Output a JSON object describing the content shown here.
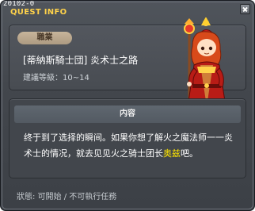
{
  "window": {
    "quest_id": "20102-0",
    "title": "QUEST INFO"
  },
  "job": {
    "badge": "職業",
    "name": "[蒂納斯騎士団] 炎术士之路",
    "level_label": "建議等級：",
    "level_value": "10~14"
  },
  "content": {
    "header": "内容",
    "text_before": "终于到了选择的瞬间。如果你想了解火之魔法师一一炎术士的情况，就去见见火之骑士团长",
    "highlight": "奥兹",
    "text_after": "吧。"
  },
  "status": {
    "text": "狀態: 可開始 / 不可執行任務"
  },
  "icons": {
    "close": "close-icon",
    "character": "mage-character-icon"
  },
  "colors": {
    "title": "#ffd24a",
    "highlight": "#ffe600",
    "badge": "#c7b49a"
  }
}
